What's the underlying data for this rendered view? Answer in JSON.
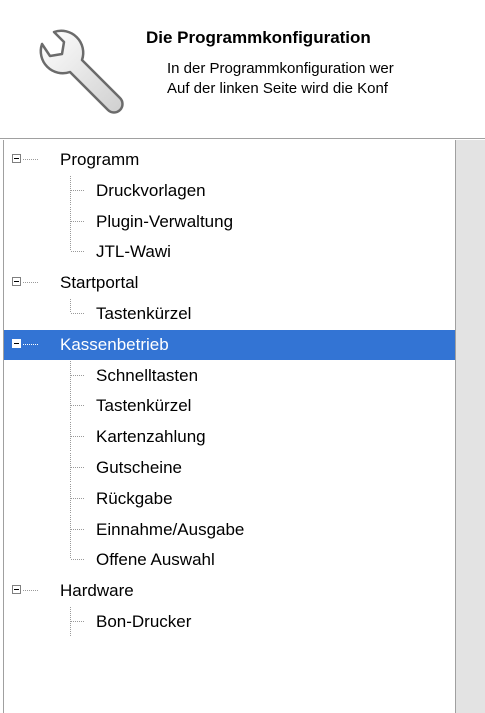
{
  "header": {
    "title": "Die Programmkonfiguration",
    "line1": "In der Programmkonfiguration wer",
    "line2": "Auf der linken Seite wird die Konf"
  },
  "tree": [
    {
      "label": "Programm",
      "level": 0,
      "selected": false
    },
    {
      "label": "Druckvorlagen",
      "level": 1
    },
    {
      "label": "Plugin-Verwaltung",
      "level": 1
    },
    {
      "label": "JTL-Wawi",
      "level": 1,
      "last": true
    },
    {
      "label": "Startportal",
      "level": 0,
      "selected": false
    },
    {
      "label": "Tastenkürzel",
      "level": 1,
      "last": true
    },
    {
      "label": "Kassenbetrieb",
      "level": 0,
      "selected": true
    },
    {
      "label": "Schnelltasten",
      "level": 1
    },
    {
      "label": "Tastenkürzel",
      "level": 1
    },
    {
      "label": "Kartenzahlung",
      "level": 1
    },
    {
      "label": "Gutscheine",
      "level": 1
    },
    {
      "label": "Rückgabe",
      "level": 1
    },
    {
      "label": "Einnahme/Ausgabe",
      "level": 1
    },
    {
      "label": "Offene Auswahl",
      "level": 1,
      "last": true
    },
    {
      "label": "Hardware",
      "level": 0,
      "selected": false
    },
    {
      "label": "Bon-Drucker",
      "level": 1
    }
  ]
}
